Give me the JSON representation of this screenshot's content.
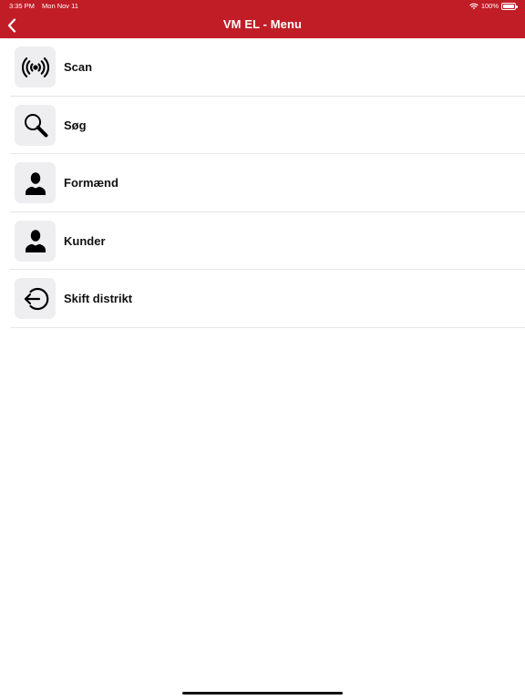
{
  "status_bar": {
    "time": "3:35 PM",
    "date": "Mon Nov 11",
    "battery": "100%",
    "icons": [
      "wifi-icon",
      "battery-icon"
    ]
  },
  "nav": {
    "title": "VM EL - Menu",
    "back_icon": "chevron-left-icon"
  },
  "menu": {
    "items": [
      {
        "label": "Scan",
        "icon": "broadcast-icon"
      },
      {
        "label": "Søg",
        "icon": "search-icon"
      },
      {
        "label": "Formænd",
        "icon": "person-icon"
      },
      {
        "label": "Kunder",
        "icon": "person-icon"
      },
      {
        "label": "Skift distrikt",
        "icon": "sign-in-icon"
      }
    ]
  },
  "colors": {
    "header": "#c11d26",
    "icon_tile": "#eeeef1",
    "separator": "#e6e6e6",
    "text": "#111111"
  }
}
